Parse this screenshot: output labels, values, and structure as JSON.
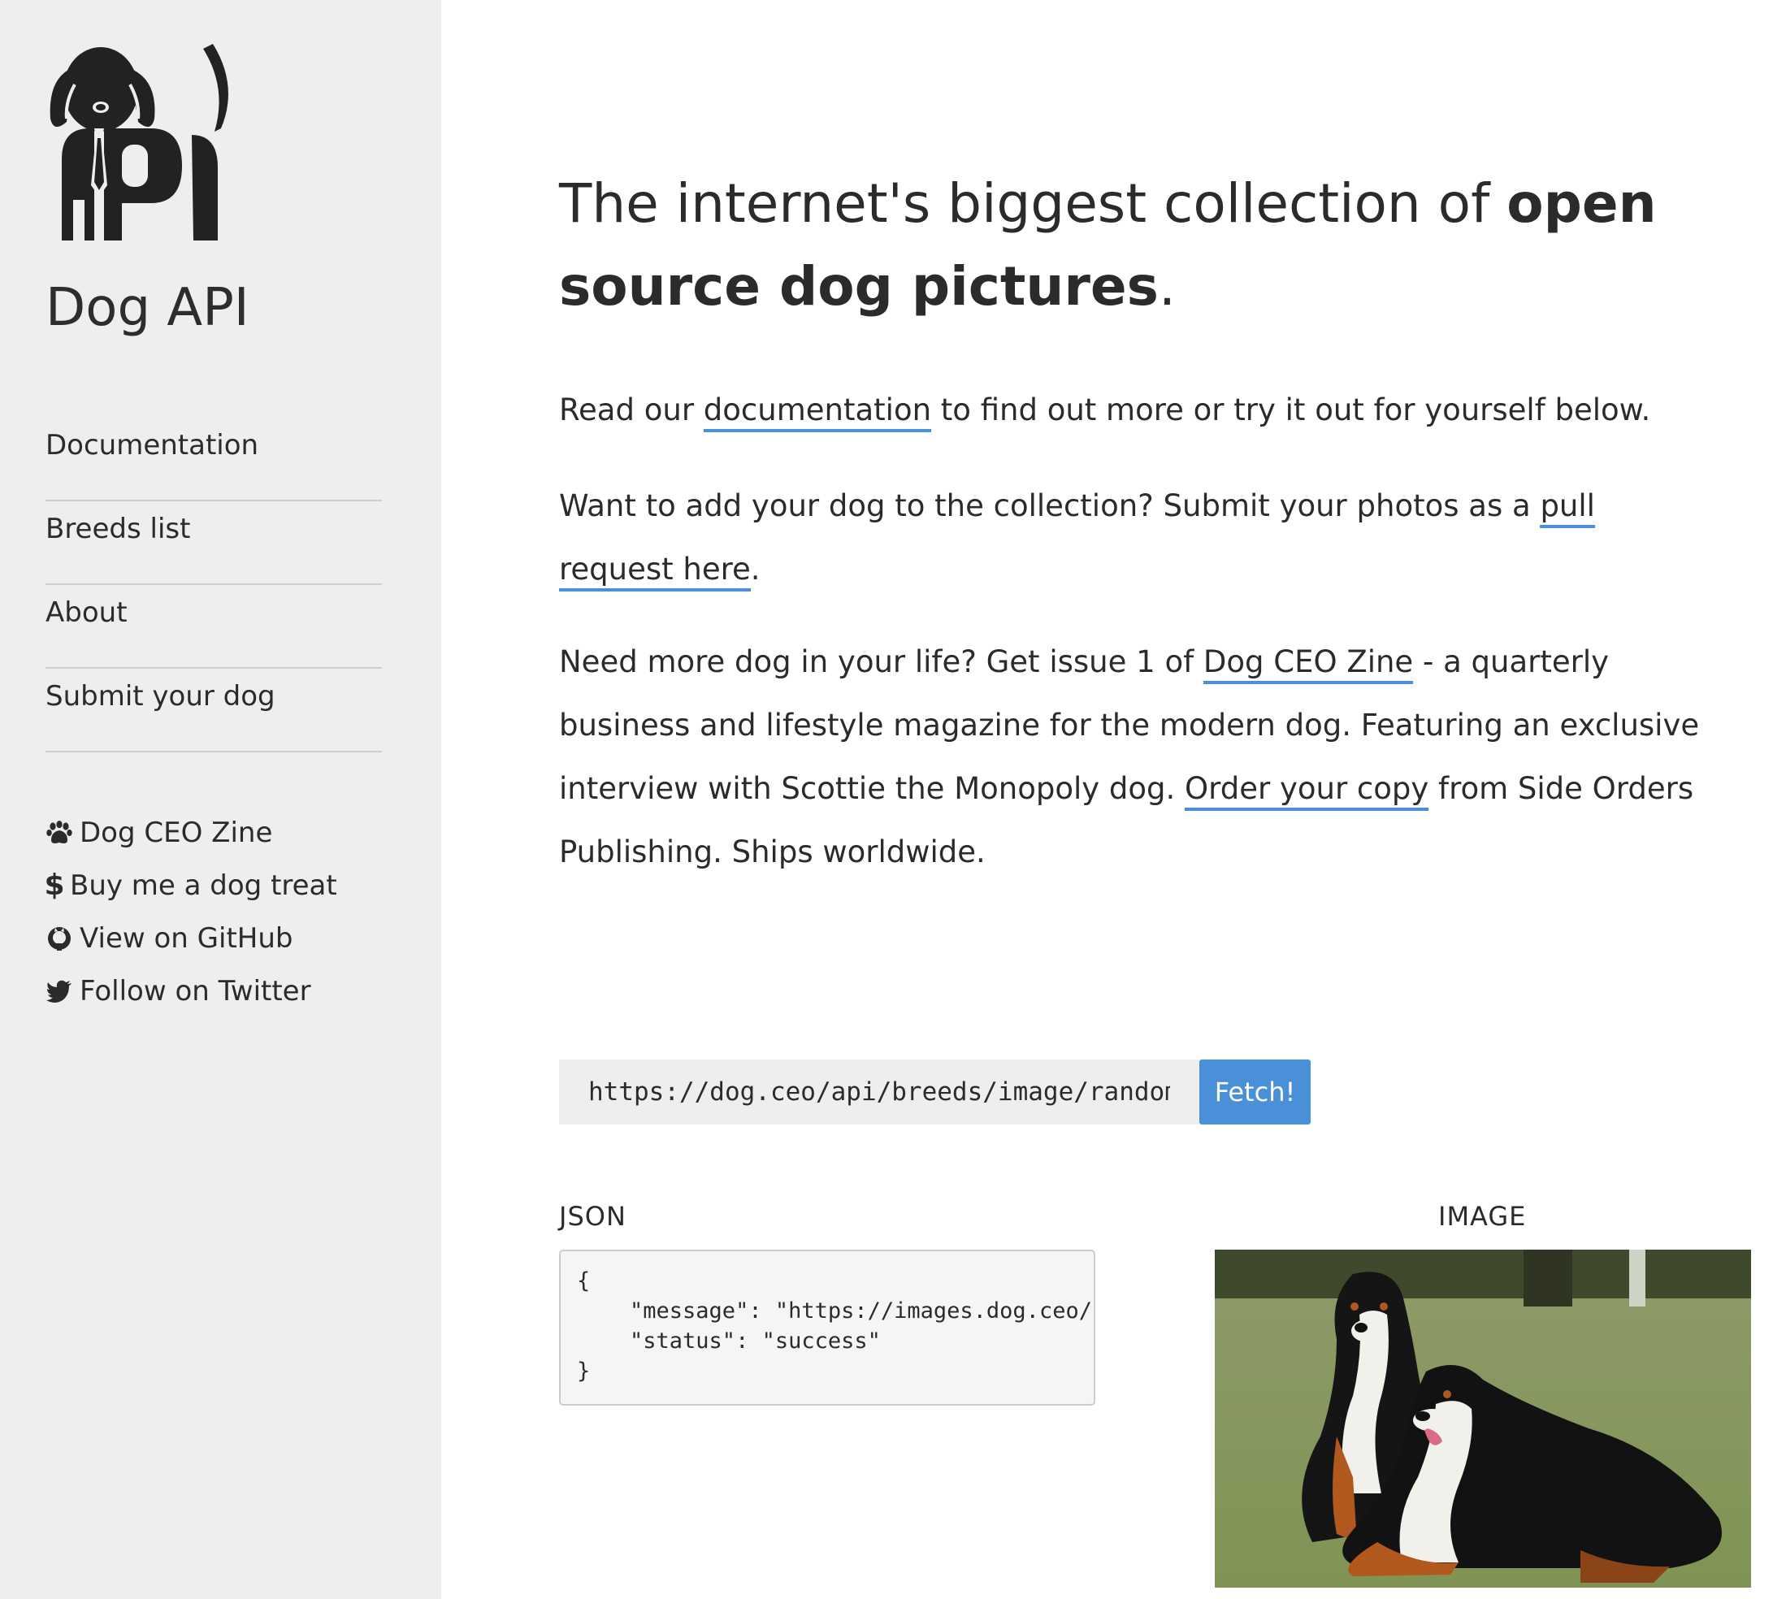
{
  "sidebar": {
    "brand": "Dog API",
    "logo_icon": "dog-api-logo",
    "nav": [
      {
        "label": "Documentation"
      },
      {
        "label": "Breeds list"
      },
      {
        "label": "About"
      },
      {
        "label": "Submit your dog"
      }
    ],
    "extras": [
      {
        "icon": "paw-icon",
        "label": "Dog CEO Zine"
      },
      {
        "icon": "dollar-icon",
        "label": "Buy me a dog treat"
      },
      {
        "icon": "github-icon",
        "label": "View on GitHub"
      },
      {
        "icon": "twitter-icon",
        "label": "Follow on Twitter"
      }
    ]
  },
  "main": {
    "headline": {
      "prefix": "The internet's biggest collection of ",
      "bold": "open source dog pictures",
      "suffix": "."
    },
    "p1": {
      "before": "Read our ",
      "link": "documentation",
      "after": " to find out more or try it out for yourself below."
    },
    "p2": {
      "before": "Want to add your dog to the collection? Submit your photos as a ",
      "link": "pull request here",
      "after": "."
    },
    "p3": {
      "before": "Need more dog in your life? Get issue 1 of ",
      "link1": "Dog CEO Zine",
      "middle": " - a quarterly business and lifestyle magazine for the modern dog. Featuring an exclusive interview with Scottie the Monopoly dog. ",
      "link2": "Order your copy",
      "after": " from Side Orders Publishing. Ships worldwide."
    },
    "fetch": {
      "endpoint_value": "https://dog.ceo/api/breeds/image/random",
      "button_label": "Fetch!"
    },
    "json_label": "JSON",
    "image_label": "IMAGE",
    "json_text": "{\n    \"message\": \"https://images.dog.ceo/br\n    \"status\": \"success\"\n}"
  },
  "colors": {
    "accent": "#4a90d9",
    "sidebar_bg": "#eeeeee",
    "text": "#2b2b2b"
  }
}
